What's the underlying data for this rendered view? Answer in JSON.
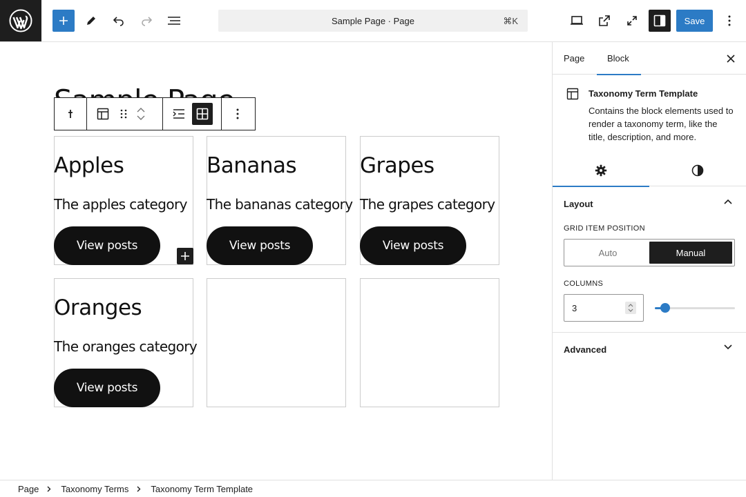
{
  "header": {
    "document_title": "Sample Page · Page",
    "shortcut": "⌘K",
    "save_label": "Save",
    "icons": [
      "wordpress-icon",
      "plus-icon",
      "pencil-icon",
      "undo-icon",
      "redo-icon",
      "list-view-icon",
      "desktop-icon",
      "external-link-icon",
      "fullscreen-icon",
      "sidebar-toggle-icon",
      "more-vertical-icon"
    ]
  },
  "canvas": {
    "page_title": "Sample Page",
    "terms": [
      {
        "title": "Apples",
        "description": "The apples category",
        "button": "View posts"
      },
      {
        "title": "Bananas",
        "description": "The bananas category",
        "button": "View posts"
      },
      {
        "title": "Grapes",
        "description": "The grapes category",
        "button": "View posts"
      },
      {
        "title": "Oranges",
        "description": "The oranges category",
        "button": "View posts"
      }
    ]
  },
  "sidebar": {
    "tabs": [
      "Page",
      "Block"
    ],
    "active_tab": "Block",
    "block": {
      "name": "Taxonomy Term Template",
      "description": "Contains the block elements used to render a taxonomy term, like the title, description, and more."
    },
    "layout": {
      "title": "Layout",
      "grid_item_position_label": "GRID ITEM POSITION",
      "options": [
        "Auto",
        "Manual"
      ],
      "selected": "Manual",
      "columns_label": "COLUMNS",
      "columns_value": "3",
      "columns_slider_fraction": 0.13
    },
    "advanced": {
      "title": "Advanced"
    }
  },
  "breadcrumb": [
    "Page",
    "Taxonomy Terms",
    "Taxonomy Term Template"
  ],
  "colors": {
    "accent": "#2c7bc5",
    "dark": "#1e1e1e",
    "border": "#e0e0e0"
  }
}
